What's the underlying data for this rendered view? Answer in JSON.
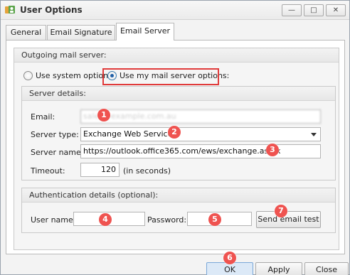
{
  "window": {
    "title": "User Options",
    "controls": {
      "minimize": "—",
      "maximize": "□",
      "close": "✕"
    }
  },
  "tabs": [
    {
      "label": "General"
    },
    {
      "label": "Email Signature"
    },
    {
      "label": "Email Server",
      "selected": true
    }
  ],
  "outgoing": {
    "heading": "Outgoing mail server:",
    "option_system": "Use system options",
    "option_custom": "Use my mail server options:",
    "selected": "custom"
  },
  "server_details": {
    "heading": "Server details:",
    "email_label": "Email:",
    "email_value": "sales@example.com.au",
    "server_type_label": "Server type:",
    "server_type_value": "Exchange Web Services",
    "server_name_label": "Server name:",
    "server_name_value": "https://outlook.office365.com/ews/exchange.asmx",
    "timeout_label": "Timeout:",
    "timeout_value": "120",
    "timeout_unit": "(in seconds)"
  },
  "auth": {
    "heading": "Authentication details (optional):",
    "username_label": "User name:",
    "username_value": "",
    "password_label": "Password:",
    "password_value": "",
    "test_button": "Send email test"
  },
  "footer": {
    "ok": "OK",
    "apply": "Apply",
    "close": "Close"
  },
  "markers": [
    "1",
    "2",
    "3",
    "4",
    "5",
    "6",
    "7"
  ],
  "colors": {
    "marker": "#ef5350",
    "highlight_box": "#e03b3b",
    "ok_button": "#dce9f7"
  }
}
